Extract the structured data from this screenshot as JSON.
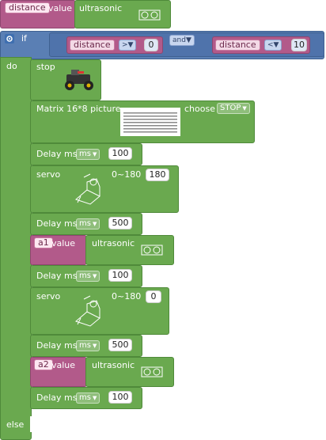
{
  "top_block": {
    "var_name": "distance",
    "value_label": "value",
    "sensor_label": "ultrasonic"
  },
  "if_block": {
    "if_label": "if",
    "left": {
      "var": "distance",
      "op": ">",
      "value": "0"
    },
    "join": "and",
    "right": {
      "var": "distance",
      "op": "<",
      "value": "10"
    },
    "do_label": "do",
    "else_label": "else"
  },
  "stop_block": {
    "label": "stop"
  },
  "matrix_block": {
    "label": "Matrix 16*8 picture",
    "choose_label": "choose",
    "choose_value": "STOP"
  },
  "delay1": {
    "label": "Delay ms",
    "unit": "ms",
    "value": "100"
  },
  "servo1": {
    "label": "servo",
    "range": "0~180",
    "value": "180"
  },
  "delay2": {
    "label": "Delay ms",
    "unit": "ms",
    "value": "500"
  },
  "a1_block": {
    "var_name": "a1",
    "value_label": "value",
    "sensor_label": "ultrasonic"
  },
  "delay3": {
    "label": "Delay ms",
    "unit": "ms",
    "value": "100"
  },
  "servo2": {
    "label": "servo",
    "range": "0~180",
    "value": "0"
  },
  "delay4": {
    "label": "Delay ms",
    "unit": "ms",
    "value": "500"
  },
  "a2_block": {
    "var_name": "a2",
    "value_label": "value",
    "sensor_label": "ultrasonic"
  },
  "delay5": {
    "label": "Delay ms",
    "unit": "ms",
    "value": "100"
  },
  "colors": {
    "logic": "#5a7fb4",
    "action": "#6aa94f",
    "variable": "#b25a8a"
  }
}
